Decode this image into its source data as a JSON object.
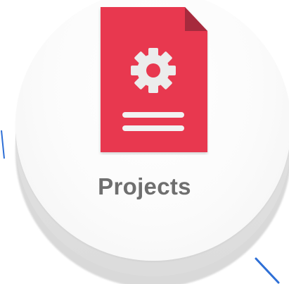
{
  "card": {
    "title": "Projects",
    "icon": "document-gear-icon"
  },
  "colors": {
    "document": "#e8384f",
    "document_fold": "#b02a3d",
    "gear": "#ececec",
    "lines": "#f2f2f2",
    "title": "#6f6f6f",
    "accent_line": "#2e6fd6",
    "disc": "#f7f7f7"
  }
}
